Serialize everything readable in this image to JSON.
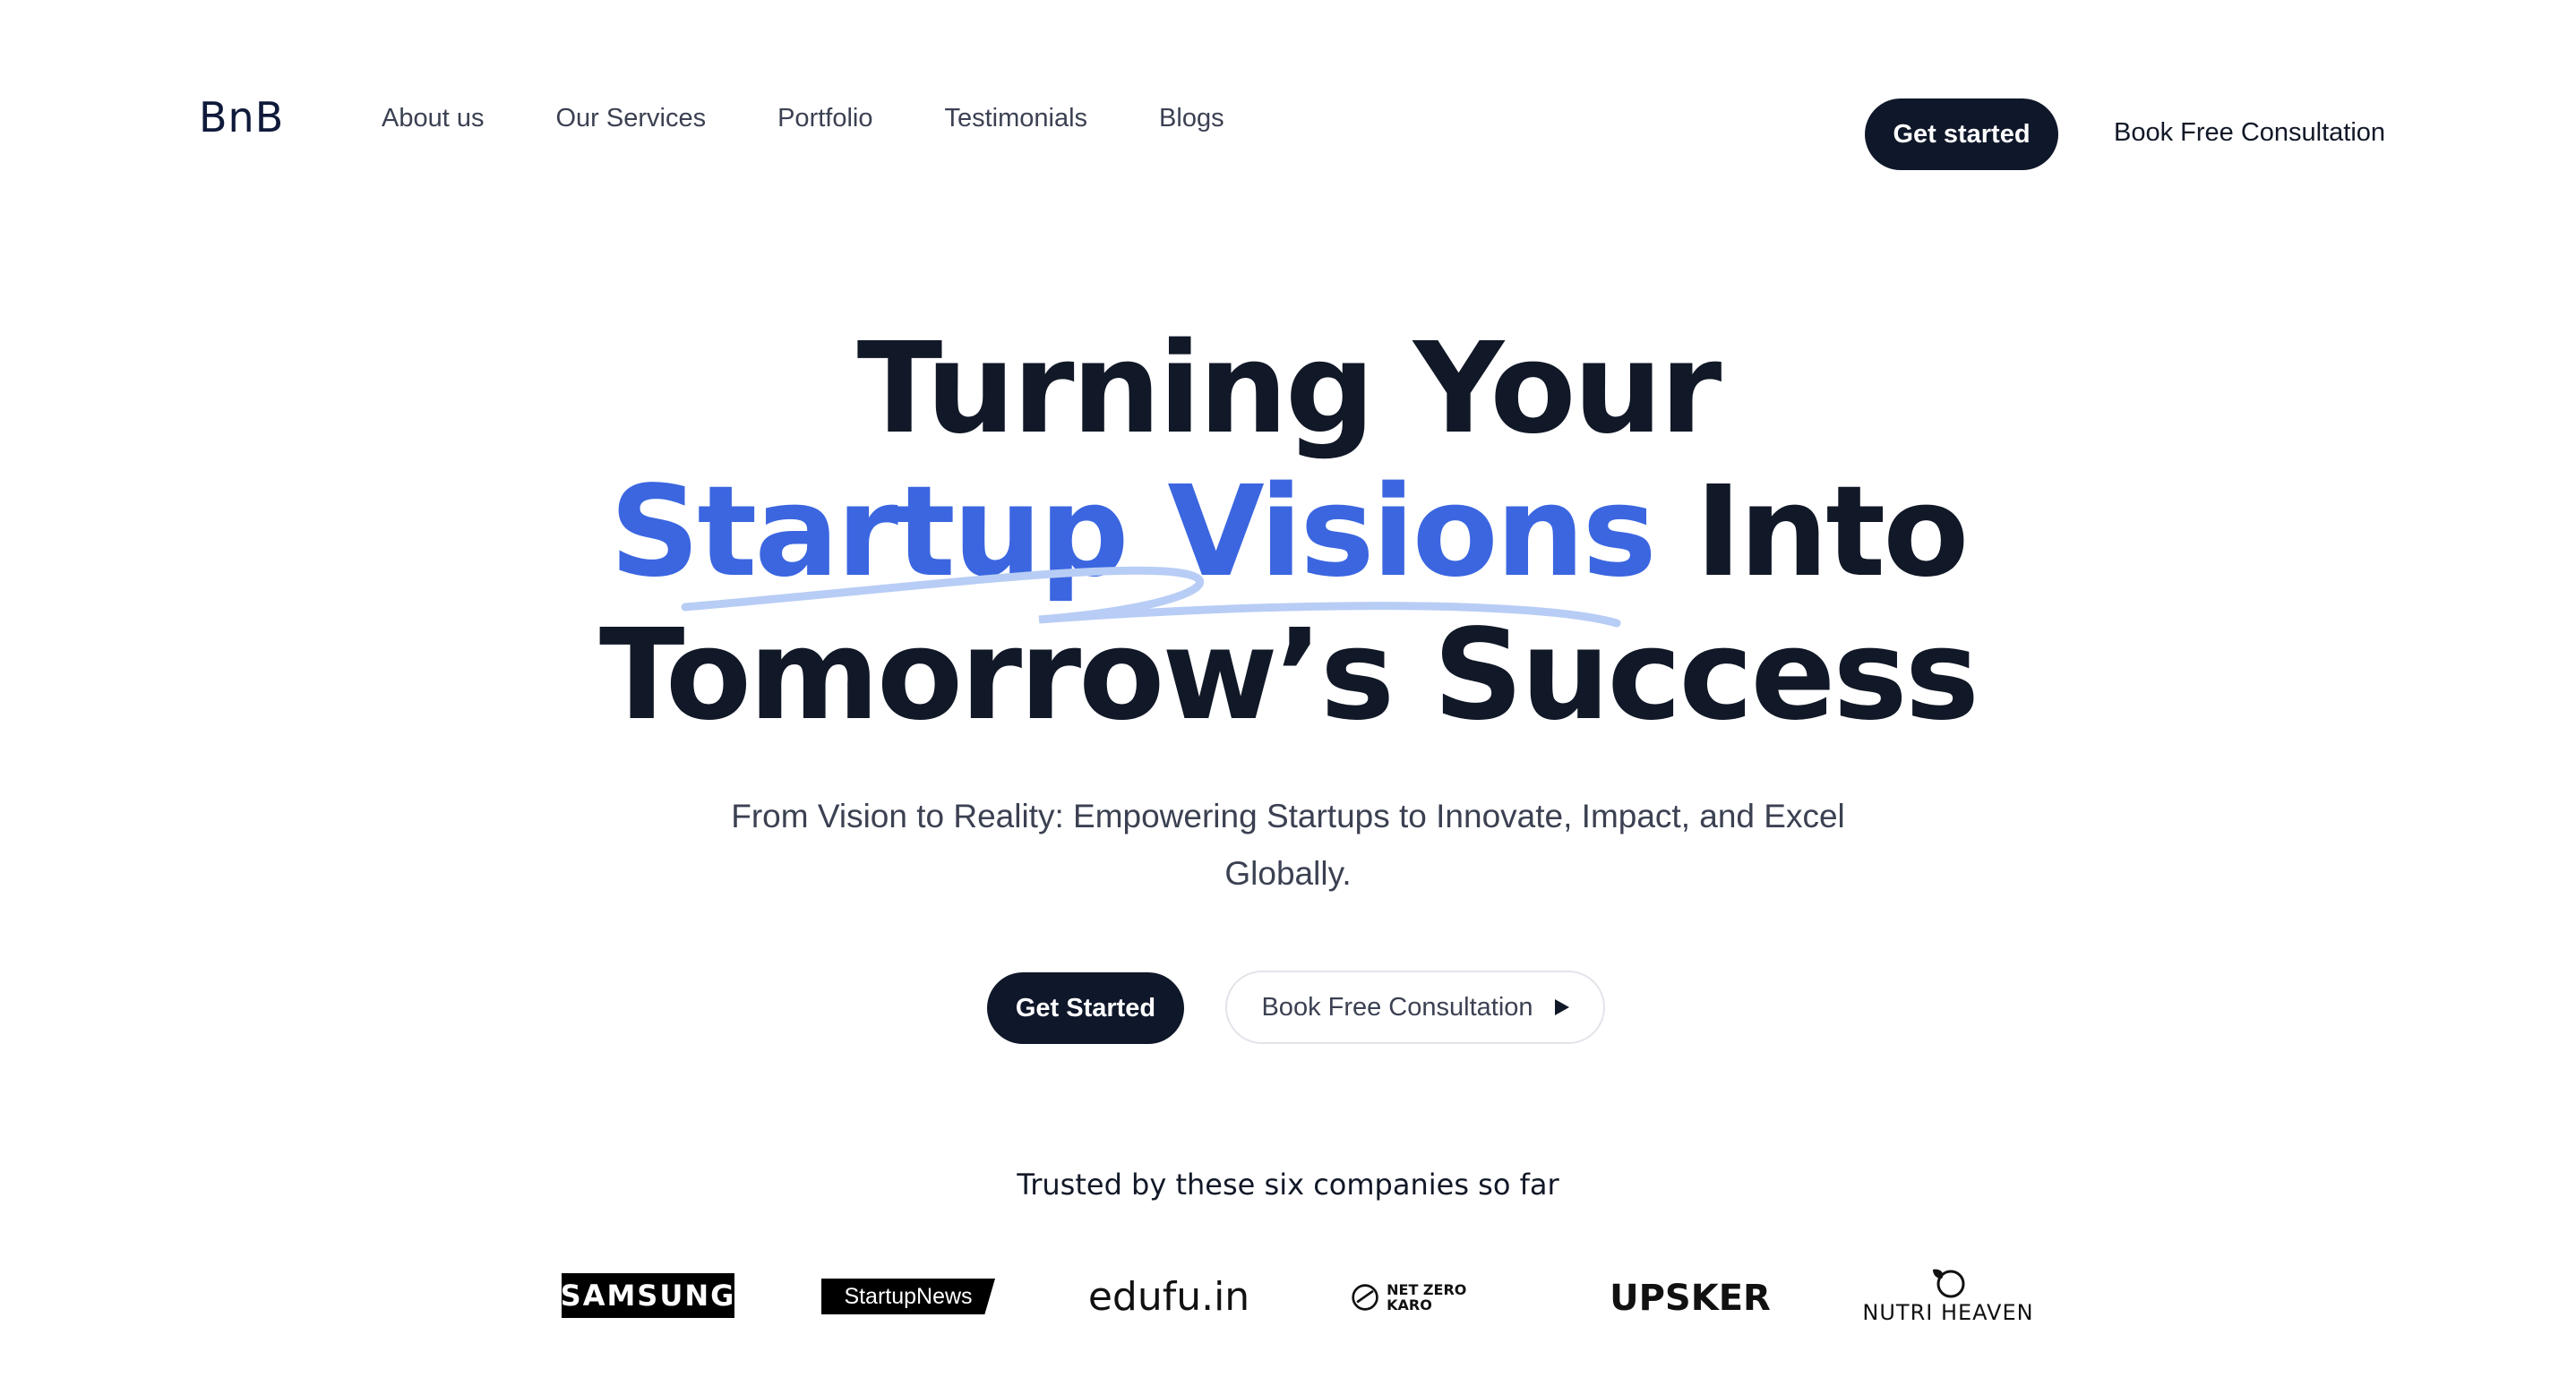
{
  "header": {
    "logo": "BnB",
    "nav": [
      "About us",
      "Our Services",
      "Portfolio",
      "Testimonials",
      "Blogs"
    ],
    "cta_label": "Get started",
    "consult_label": "Book Free Consultation"
  },
  "hero": {
    "line1": "Turning Your",
    "line2_highlight": "Startup Visions",
    "line2_rest": " Into",
    "line3": "Tomorrow’s Success",
    "subtitle": "From Vision to Reality: Empowering Startups to Innovate, Impact, and Excel Globally.",
    "primary_button": "Get Started",
    "secondary_button": "Book Free Consultation"
  },
  "trusted": {
    "heading": "Trusted by these six companies so far",
    "logos": [
      {
        "name": "SAMSUNG",
        "icon": "samsung-logo"
      },
      {
        "name": "StartupNews",
        "icon": "startupnews-logo"
      },
      {
        "name": "edufu.in",
        "icon": "edufu-logo"
      },
      {
        "name": "NET ZERO KARO",
        "icon": "netzerokaro-logo"
      },
      {
        "name": "UPSKER",
        "icon": "upsker-logo"
      },
      {
        "name": "NUTRI HEAVEN",
        "icon": "nutriheaven-logo"
      }
    ]
  },
  "colors": {
    "accent": "#3b66e0",
    "dark": "#0f172a",
    "swoosh": "#b8cdf5"
  }
}
